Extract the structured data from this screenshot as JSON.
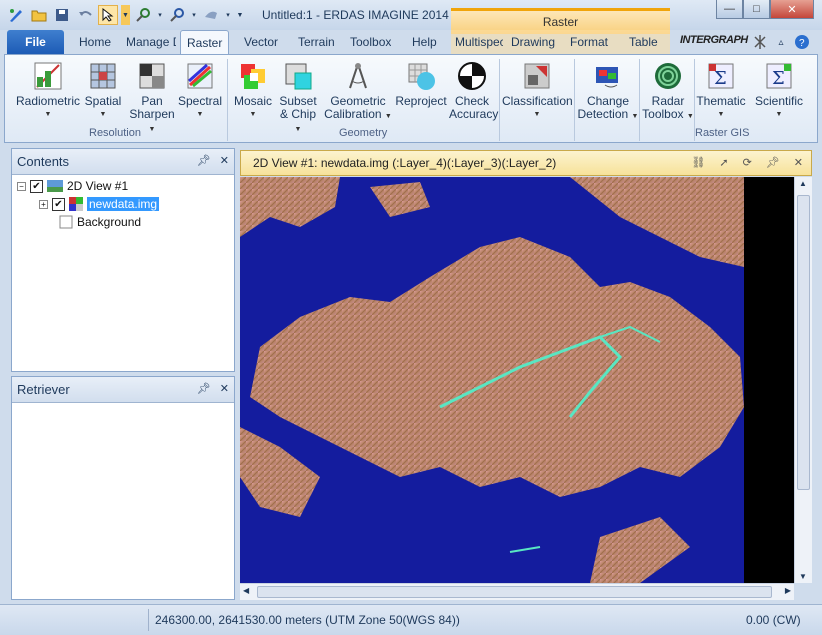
{
  "window": {
    "title": "Untitled:1 - ERDAS IMAGINE 2014",
    "contextual_tab_group": "Raster",
    "controls": {
      "minimize": "—",
      "maximize": "□",
      "close": "✕"
    }
  },
  "tabs": {
    "file": "File",
    "items": [
      "Home",
      "Manage Data",
      "Raster",
      "Vector",
      "Terrain",
      "Toolbox",
      "Help",
      "Multispectral",
      "Drawing",
      "Format",
      "Table"
    ],
    "active": "Raster"
  },
  "brand": {
    "logo_text": "INTERGRAPH"
  },
  "ribbon": {
    "resolution_group": {
      "label": "Resolution",
      "buttons": [
        {
          "line1": "Radiometric",
          "line2": ""
        },
        {
          "line1": "Spatial",
          "line2": ""
        },
        {
          "line1": "Pan",
          "line2": "Sharpen"
        },
        {
          "line1": "Spectral",
          "line2": ""
        }
      ]
    },
    "geometry_group": {
      "label": "Geometry",
      "buttons": [
        {
          "line1": "Mosaic",
          "line2": ""
        },
        {
          "line1": "Subset",
          "line2": "& Chip"
        },
        {
          "line1": "Geometric",
          "line2": "Calibration"
        },
        {
          "line1": "Reproject",
          "line2": ""
        },
        {
          "line1": "Check",
          "line2": "Accuracy"
        }
      ]
    },
    "other_buttons": [
      {
        "line1": "Classification",
        "line2": ""
      },
      {
        "line1": "Change",
        "line2": "Detection"
      },
      {
        "line1": "Radar",
        "line2": "Toolbox"
      }
    ],
    "raster_gis_group": {
      "label": "Raster GIS",
      "buttons": [
        {
          "line1": "Thematic",
          "line2": ""
        },
        {
          "line1": "Scientific",
          "line2": ""
        }
      ]
    }
  },
  "contents_panel": {
    "title": "Contents",
    "tree": {
      "view": "2D View #1",
      "layer": "newdata.img",
      "background": "Background"
    }
  },
  "retriever_panel": {
    "title": "Retriever"
  },
  "view": {
    "title": "2D View #1: newdata.img (:Layer_4)(:Layer_3)(:Layer_2)"
  },
  "status": {
    "coordinates": "246300.00, 2641530.00 meters (UTM Zone 50(WGS 84))",
    "rotation": "0.00 (CW)"
  },
  "colors": {
    "water": "#141c9e",
    "terrain": "#c58b8a",
    "file_tab": "#1d5bb5",
    "contextual": "#f8cf7d"
  }
}
